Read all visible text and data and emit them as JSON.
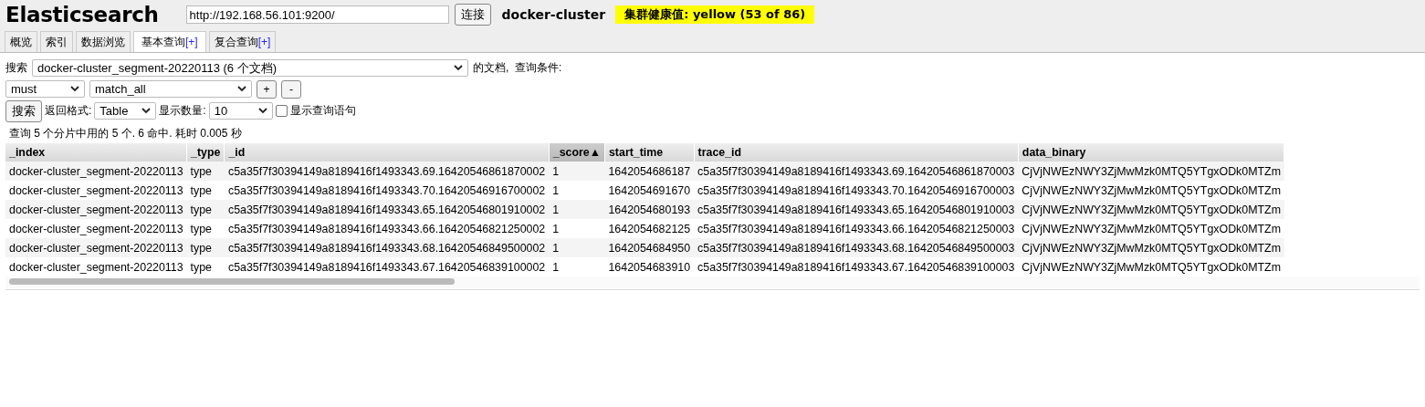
{
  "header": {
    "title": "Elasticsearch",
    "url": "http://192.168.56.101:9200/",
    "connect_button": "连接",
    "cluster_name": "docker-cluster",
    "health": "集群健康值: yellow (53 of 86)"
  },
  "tabs": [
    {
      "label": "概览",
      "selected": false
    },
    {
      "label": "索引",
      "selected": false
    },
    {
      "label": "数据浏览",
      "selected": false
    },
    {
      "label": "基本查询",
      "add": "[+]",
      "selected": true
    },
    {
      "label": "复合查询",
      "add": "[+]",
      "selected": false
    }
  ],
  "query": {
    "search_label": "搜索",
    "index_select": "docker-cluster_segment-20220113 (6 个文档)",
    "docs_label": "的文档,  查询条件:",
    "bool_select": "must",
    "match_select": "match_all",
    "add_button": "+",
    "remove_button": "-",
    "search_button": "搜索",
    "format_label": "返回格式:",
    "format_select": "Table",
    "size_label": "显示数量:",
    "size_select": "10",
    "show_query": {
      "label": "显示查询语句",
      "checked": false
    }
  },
  "summary": "查询 5 个分片中用的 5 个. 6 命中. 耗时 0.005 秒",
  "table": {
    "columns": [
      {
        "label": "_index",
        "sorted": false
      },
      {
        "label": "_type",
        "sorted": false
      },
      {
        "label": "_id",
        "sorted": false
      },
      {
        "label": "_score",
        "sorted": true,
        "sort_indicator": "▲"
      },
      {
        "label": "start_time",
        "sorted": false
      },
      {
        "label": "trace_id",
        "sorted": false
      },
      {
        "label": "data_binary",
        "sorted": false
      }
    ],
    "rows": [
      [
        "docker-cluster_segment-20220113",
        "type",
        "c5a35f7f30394149a8189416f1493343.69.16420546861870002",
        "1",
        "1642054686187",
        "c5a35f7f30394149a8189416f1493343.69.16420546861870003",
        "CjVjNWEzNWY3ZjMwMzk0MTQ5YTgxODk0MTZm"
      ],
      [
        "docker-cluster_segment-20220113",
        "type",
        "c5a35f7f30394149a8189416f1493343.70.16420546916700002",
        "1",
        "1642054691670",
        "c5a35f7f30394149a8189416f1493343.70.16420546916700003",
        "CjVjNWEzNWY3ZjMwMzk0MTQ5YTgxODk0MTZm"
      ],
      [
        "docker-cluster_segment-20220113",
        "type",
        "c5a35f7f30394149a8189416f1493343.65.16420546801910002",
        "1",
        "1642054680193",
        "c5a35f7f30394149a8189416f1493343.65.16420546801910003",
        "CjVjNWEzNWY3ZjMwMzk0MTQ5YTgxODk0MTZm"
      ],
      [
        "docker-cluster_segment-20220113",
        "type",
        "c5a35f7f30394149a8189416f1493343.66.16420546821250002",
        "1",
        "1642054682125",
        "c5a35f7f30394149a8189416f1493343.66.16420546821250003",
        "CjVjNWEzNWY3ZjMwMzk0MTQ5YTgxODk0MTZm"
      ],
      [
        "docker-cluster_segment-20220113",
        "type",
        "c5a35f7f30394149a8189416f1493343.68.16420546849500002",
        "1",
        "1642054684950",
        "c5a35f7f30394149a8189416f1493343.68.16420546849500003",
        "CjVjNWEzNWY3ZjMwMzk0MTQ5YTgxODk0MTZm"
      ],
      [
        "docker-cluster_segment-20220113",
        "type",
        "c5a35f7f30394149a8189416f1493343.67.16420546839100002",
        "1",
        "1642054683910",
        "c5a35f7f30394149a8189416f1493343.67.16420546839100003",
        "CjVjNWEzNWY3ZjMwMzk0MTQ5YTgxODk0MTZm"
      ]
    ]
  }
}
